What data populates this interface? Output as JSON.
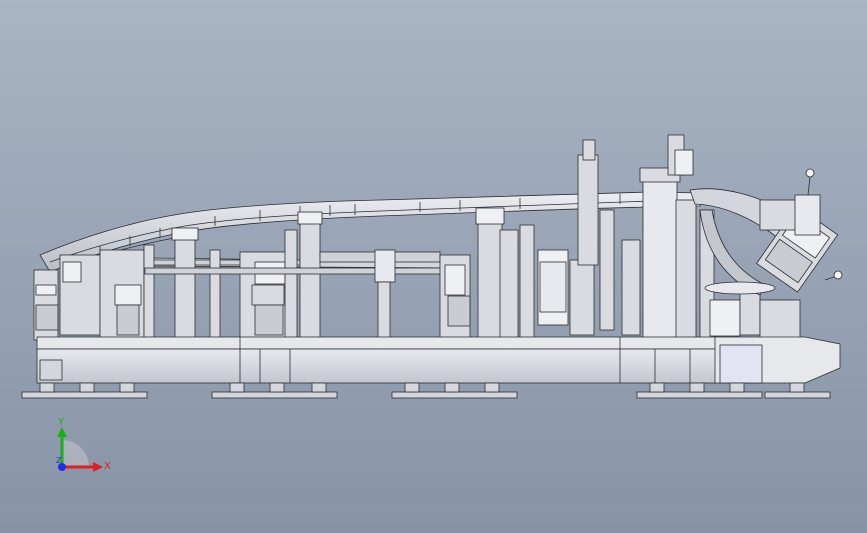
{
  "viewport": {
    "background_top": "#a9b4c4",
    "background_bottom": "#8794a6"
  },
  "model": {
    "part_fill": "#d9dbe0",
    "part_fill_dark": "#bfc2c9",
    "edge_color": "#2b2d33",
    "accent_fill": "#eef0f4",
    "highlight_fill": "#e7e9ef"
  },
  "triad": {
    "x_label": "X",
    "y_label": "Y",
    "z_label": "Z",
    "x_color": "#e02020",
    "y_color": "#18b018",
    "z_color": "#2030e0"
  }
}
